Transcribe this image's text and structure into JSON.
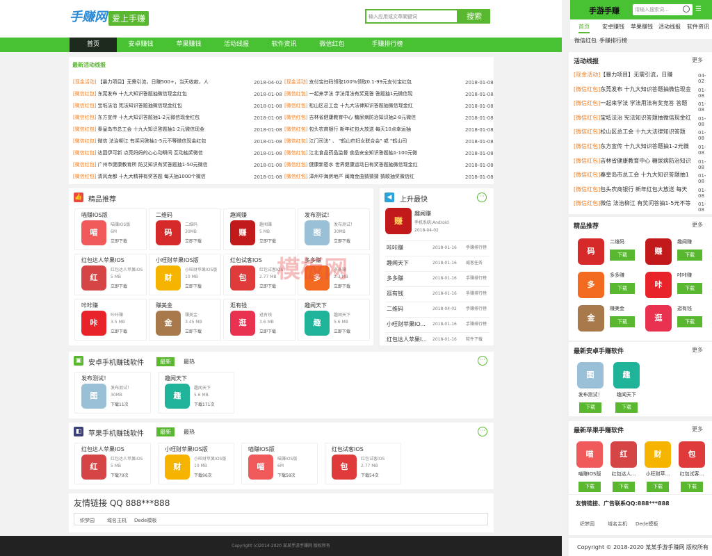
{
  "brand": {
    "logo": "手赚网",
    "slogan": "爱上手赚",
    "search_placeholder": "输入应用或文章關键词",
    "search_button": "搜索"
  },
  "nav": [
    "首页",
    "安卓赚钱",
    "苹果赚钱",
    "活动线报",
    "软件资讯",
    "微信红包",
    "手赚排行榜"
  ],
  "news": {
    "title": "最新活动线报",
    "left": [
      [
        "[现金活动]",
        "【暴力项目】无需引流，日赚500+，当天收款，人",
        "2018-04-02"
      ],
      [
        "[微信红包]",
        "东莞发布 十九大知识答题抽微信现金红包",
        "2018-01-08"
      ],
      [
        "[微信红包]",
        "宝坻法治 宪法知识答题抽微信现金红包",
        "2018-01-08"
      ],
      [
        "[微信红包]",
        "东方宣传 十九大知识答题抽1-2元微信现金红包",
        "2018-01-08"
      ],
      [
        "[微信红包]",
        "秦皇岛市总工会 十九大知识答题抽1-2元微信现金",
        "2018-01-08"
      ],
      [
        "[微信红包]",
        "微信 法治柳江 有奖问答抽1-5元不等微信现金红包",
        "2018-01-08"
      ],
      [
        "[微信红包]",
        "达因伊可新 点亮妈妈的心心动瞬间 互动抽奖微信",
        "2018-01-08"
      ],
      [
        "[微信红包]",
        "广州市健康教育所 防艾知识有奖答题抽1-50元微信",
        "2018-01-08"
      ],
      [
        "[微信红包]",
        "清风龙都 十九大精神有奖答题 每天抽1000个微信",
        "2018-01-08"
      ]
    ],
    "right": [
      [
        "[现金活动]",
        "支付宝扫码领取100%领取0.1-99元支付宝红包",
        "2018-01-08"
      ],
      [
        "[微信红包]",
        "一起来学法 学法用法有奖竞答 答题抽1元微信现",
        "2018-01-08"
      ],
      [
        "[微信红包]",
        "松山区总工会 十九大法律知识答题抽微信现金红",
        "2018-01-08"
      ],
      [
        "[微信红包]",
        "吉林省健康教育中心 糖尿病防治知识抽2-8元微信",
        "2018-01-08"
      ],
      [
        "[微信红包]",
        "包头农商银行 新年红包大放送 每天10点幸运抽",
        "2018-01-08"
      ],
      [
        "[微信红包]",
        "江门司法\" 、 \"鹤山市妇女联合会\" 或 \"鹤山司",
        "2018-01-08"
      ],
      [
        "[微信红包]",
        "江北食品药品监督 食品安全知识答题抽1-100元微",
        "2018-01-08"
      ],
      [
        "[微信红包]",
        "健康新密水 世界健康运动日有奖答题抽微信现金红",
        "2018-01-08"
      ],
      [
        "[微信红包]",
        "漳州中海房地产 闽南金曲猜猜猜 猜歌抽奖微信红",
        "2018-01-08"
      ]
    ]
  },
  "featured": {
    "title": "精品推荐",
    "items": [
      [
        "喵赚IOS版",
        "喵赚IOS版",
        "6M",
        "立即下载"
      ],
      [
        "二维码",
        "二维码",
        "30MB",
        "立即下载"
      ],
      [
        "趣闻赚",
        "趣闻赚",
        "5 MB",
        "立即下载"
      ],
      [
        "发布测试！",
        "发布测试！",
        "30MB",
        "立即下载"
      ],
      [
        "红包达人苹果IOS",
        "红包达人苹果IOS",
        "5 MB",
        "立即下载"
      ],
      [
        "小旺财苹果IOS版",
        "小旺财苹果IOS版",
        "10 MB",
        "立即下载"
      ],
      [
        "红包试客IOS",
        "红包试客IOS",
        "2.77 MB",
        "立即下载"
      ],
      [
        "多多赚",
        "多多赚",
        "2.3 MB",
        "立即下载"
      ],
      [
        "咔咔赚",
        "咔咔赚",
        "3.5 MB",
        "立即下载"
      ],
      [
        "赚美金",
        "赚美金",
        "3.45 MB",
        "立即下载"
      ],
      [
        "逛有钱",
        "逛有钱",
        "3.6 MB",
        "立即下载"
      ],
      [
        "趣闻天下",
        "趣闻天下",
        "5.6 MB",
        "立即下载"
      ]
    ]
  },
  "rising": {
    "title": "上升最快",
    "top_name": "趣闻赚",
    "top_system": "手机系统:Android",
    "top_date": "2018-04-02",
    "rows": [
      [
        "咔咔赚",
        "2018-01-16",
        "手赚排行榜"
      ],
      [
        "趣闻天下",
        "2018-01-16",
        "威客任务"
      ],
      [
        "多多赚",
        "2018-01-16",
        "手赚排行榜"
      ],
      [
        "逛有钱",
        "2018-01-16",
        "手赚排行榜"
      ],
      [
        "二维码",
        "2018-04-02",
        "手赚排行榜"
      ],
      [
        "小旺财苹果IO...",
        "2018-01-16",
        "手赚排行榜"
      ],
      [
        "红包达人苹果I...",
        "2018-01-16",
        "软件下载"
      ]
    ]
  },
  "android": {
    "title": "安卓手机赚钱软件",
    "tab_new": "最新",
    "tab_hot": "最热",
    "items": [
      [
        "发布测试！",
        "发布测试！",
        "30MB",
        "下载11次"
      ],
      [
        "趣闻天下",
        "趣闻天下",
        "5.6 MB",
        "下载171次"
      ]
    ]
  },
  "apple": {
    "title": "苹果手机赚钱软件",
    "tab_new": "最新",
    "tab_hot": "最热",
    "items": [
      [
        "红包达人苹果IOS",
        "红包达人苹果IOS",
        "5 MB",
        "下载79次"
      ],
      [
        "小旺财苹果IOS版",
        "小旺财苹果IOS版",
        "10 MB",
        "下载96次"
      ],
      [
        "喵赚IOS版",
        "喵赚IOS版",
        "6M",
        "下载58次"
      ],
      [
        "红包试客IOS",
        "红包试客IOS",
        "2.77 MB",
        "下载54次"
      ]
    ]
  },
  "links": {
    "title": "友情链接 QQ 888***888",
    "items": [
      "织梦园",
      "域名主机",
      "Dede模板"
    ]
  },
  "footer": "Copyright (c)2014-2020 某某手游手赚网 版权所有",
  "watermark": "模板网",
  "side": {
    "logo": "手游手赚",
    "search_placeholder": "请输入搜索词...",
    "nav": [
      "首页",
      "安卓赚钱",
      "苹果赚钱",
      "活动线报",
      "软件资讯",
      "微信红包",
      "手赚排行榜"
    ],
    "news_title": "活动线报",
    "more": "更多",
    "news": [
      [
        "[现金活动]",
        "【暴力项目】无需引流，日赚",
        "04-02"
      ],
      [
        "[微信红包]",
        "东莞发布 十九大知识答题抽微信现金",
        "01-08"
      ],
      [
        "[微信红包]",
        "一起来学法 学法用法有奖竞答 答题",
        "01-08"
      ],
      [
        "[微信红包]",
        "宝坻法治 宪法知识答题抽微信现金红",
        "01-08"
      ],
      [
        "[微信红包]",
        "松山区总工会 十九大法律知识答题",
        "01-08"
      ],
      [
        "[微信红包]",
        "东方宣传 十九大知识答题抽1-2元微",
        "01-08"
      ],
      [
        "[微信红包]",
        "吉林省健康教育中心 糖尿病防治知识",
        "01-08"
      ],
      [
        "[微信红包]",
        "秦皇岛市总工会 十九大知识答题抽1",
        "01-08"
      ],
      [
        "[微信红包]",
        "包头农商银行 新年红包大放送 每天",
        "01-08"
      ],
      [
        "[微信红包]",
        "微信 法治柳江 有奖问答抽1-5元不等",
        "01-08"
      ]
    ],
    "featured_title": "精品推荐",
    "download": "下载",
    "featured": [
      "二维码",
      "趣闻赚",
      "多多赚",
      "咔咔赚",
      "赚美金",
      "逛有钱"
    ],
    "android_title": "最新安卓手赚软件",
    "android": [
      "发布测试！",
      "趣闻天下"
    ],
    "apple_title": "最新苹果手赚软件",
    "apple": [
      "喵赚IOS版",
      "红包达人...",
      "小旺财苹...",
      "红包试客..."
    ],
    "links_title": "友情链接、广告联系QQ:888***888",
    "links": [
      "织梦园",
      "域名主机",
      "Dede模板"
    ],
    "copyright": "Copyright © 2018-2020 某某手游手赚网 版权所有"
  }
}
